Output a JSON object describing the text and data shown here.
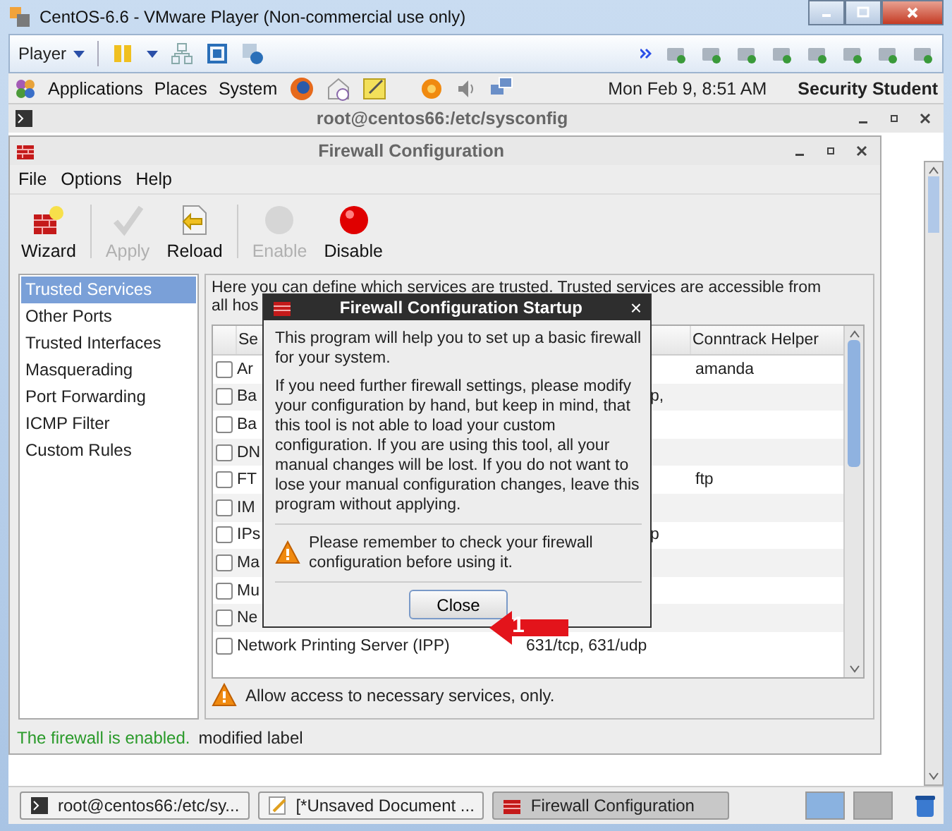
{
  "window": {
    "title": "CentOS-6.6 - VMware Player (Non-commercial use only)"
  },
  "player_toolbar": {
    "menu": "Player"
  },
  "panel": {
    "menus": [
      "Applications",
      "Places",
      "System"
    ],
    "clock": "Mon Feb  9,  8:51 AM",
    "user": "Security Student"
  },
  "terminal": {
    "title": "root@centos66:/etc/sysconfig"
  },
  "firewall": {
    "title": "Firewall Configuration",
    "menus": [
      "File",
      "Options",
      "Help"
    ],
    "toolbar": [
      {
        "kind": "wizard",
        "label": "Wizard",
        "disabled": false
      },
      {
        "kind": "apply",
        "label": "Apply",
        "disabled": true
      },
      {
        "kind": "reload",
        "label": "Reload",
        "disabled": false
      },
      {
        "kind": "enable",
        "label": "Enable",
        "disabled": true
      },
      {
        "kind": "disable",
        "label": "Disable",
        "disabled": false
      }
    ],
    "sidebar": {
      "items": [
        {
          "label": "Trusted Services",
          "selected": true
        },
        {
          "label": "Other Ports",
          "selected": false
        },
        {
          "label": "Trusted Interfaces",
          "selected": false
        },
        {
          "label": "Masquerading",
          "selected": false
        },
        {
          "label": "Port Forwarding",
          "selected": false
        },
        {
          "label": "ICMP Filter",
          "selected": false
        },
        {
          "label": "Custom Rules",
          "selected": false
        }
      ]
    },
    "intro": [
      "Here you can define which services are trusted. Trusted services are accessible from",
      "all hos"
    ],
    "table": {
      "columns": [
        "Se",
        "Conntrack Helper"
      ],
      "rows": [
        {
          "service": "Ar",
          "helper": "amanda",
          "checked": false
        },
        {
          "service": "Ba",
          "port": "p,",
          "partial": true,
          "checked": false
        },
        {
          "service": "Ba",
          "checked": false
        },
        {
          "service": "DN",
          "checked": false
        },
        {
          "service": "FT",
          "helper": "ftp",
          "checked": false
        },
        {
          "service": "IM",
          "checked": false
        },
        {
          "service": "IPs",
          "port": "p",
          "partial": true,
          "checked": false
        },
        {
          "service": "Ma",
          "checked": false
        },
        {
          "service": "Mu",
          "checked": false
        },
        {
          "service": "Ne",
          "checked": false
        },
        {
          "service": "Network Printing Server (IPP)",
          "port": "631/tcp, 631/udp",
          "checked": false
        }
      ]
    },
    "warning": "Allow access to necessary services, only.",
    "status": {
      "state": "The firewall is enabled.",
      "note": "modified label"
    }
  },
  "dialog": {
    "title": "Firewall Configuration Startup",
    "paragraphs": [
      "This program will help you to set up a basic firewall for your system.",
      "If you need further firewall settings, please modify your configuration by hand, but keep in mind, that this tool is not able to load your custom configuration. If you are using this tool, all your manual changes will be lost. If you do not want to lose your manual configuration changes, leave this program without applying."
    ],
    "warning": "Please remember to check your firewall configuration before using it.",
    "button": "Close",
    "close_glyph": "×"
  },
  "annotation": {
    "label": "1"
  },
  "taskbar": {
    "items": [
      {
        "label": "root@centos66:/etc/sy...",
        "kind": "terminal",
        "selected": false
      },
      {
        "label": "[*Unsaved Document ...",
        "kind": "editor",
        "selected": false
      },
      {
        "label": "Firewall Configuration",
        "kind": "firewall",
        "selected": true
      }
    ],
    "workspaces": [
      {
        "selected": true
      },
      {
        "selected": false
      }
    ]
  }
}
